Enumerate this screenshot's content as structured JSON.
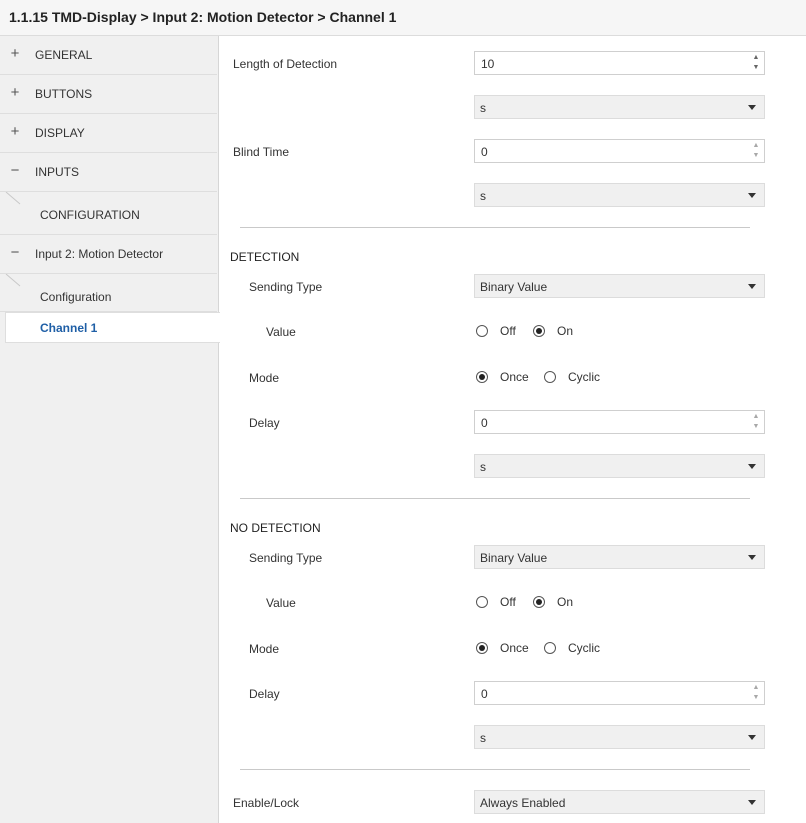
{
  "header": {
    "title": "1.1.15 TMD-Display > Input 2: Motion Detector > Channel 1"
  },
  "sidebar": {
    "items": [
      {
        "symbol": "+",
        "label": "GENERAL"
      },
      {
        "symbol": "+",
        "label": "BUTTONS"
      },
      {
        "symbol": "+",
        "label": "DISPLAY"
      },
      {
        "symbol": "−",
        "label": "INPUTS"
      },
      {
        "label": "CONFIGURATION"
      },
      {
        "symbol": "−",
        "label": "Input 2: Motion Detector"
      },
      {
        "label": "Configuration"
      },
      {
        "label": "Channel 1",
        "active": true
      }
    ]
  },
  "params": {
    "length_of_detection": {
      "label": "Length of Detection",
      "value": "10",
      "unit": "s"
    },
    "blind_time": {
      "label": "Blind Time",
      "value": "0",
      "unit": "s"
    }
  },
  "detection": {
    "title": "DETECTION",
    "sending_type": {
      "label": "Sending Type",
      "value": "Binary Value"
    },
    "value": {
      "label": "Value",
      "options": [
        "Off",
        "On"
      ],
      "selected": "On"
    },
    "mode": {
      "label": "Mode",
      "options": [
        "Once",
        "Cyclic"
      ],
      "selected": "Once"
    },
    "delay": {
      "label": "Delay",
      "value": "0",
      "unit": "s"
    }
  },
  "no_detection": {
    "title": "NO DETECTION",
    "sending_type": {
      "label": "Sending Type",
      "value": "Binary Value"
    },
    "value": {
      "label": "Value",
      "options": [
        "Off",
        "On"
      ],
      "selected": "On"
    },
    "mode": {
      "label": "Mode",
      "options": [
        "Once",
        "Cyclic"
      ],
      "selected": "Once"
    },
    "delay": {
      "label": "Delay",
      "value": "0",
      "unit": "s"
    }
  },
  "enable_lock": {
    "label": "Enable/Lock",
    "value": "Always Enabled"
  }
}
